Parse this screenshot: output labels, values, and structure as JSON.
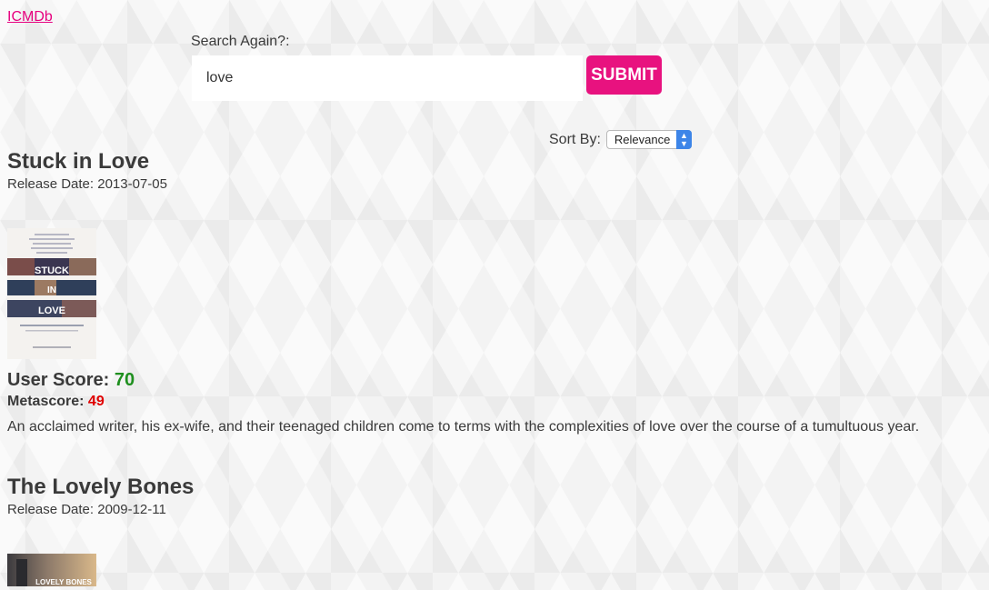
{
  "brand": {
    "label": "ICMDb"
  },
  "search": {
    "label": "Search Again?:",
    "value": "love",
    "submit_label": "SUBMIT"
  },
  "sort": {
    "label": "Sort By:",
    "selected": "Relevance"
  },
  "results": [
    {
      "title": "Stuck in Love",
      "release_date": "Release Date: 2013-07-05",
      "poster_text": [
        "STUCK",
        "IN",
        "LOVE"
      ],
      "user_score_label": "User Score: ",
      "user_score": "70",
      "metascore_label": "Metascore: ",
      "metascore": "49",
      "overview": "An acclaimed writer, his ex-wife, and their teenaged children come to terms with the complexities of love over the course of a tumultuous year."
    },
    {
      "title": "The Lovely Bones",
      "release_date": "Release Date: 2009-12-11",
      "poster_text": [
        "LOVELY BONES"
      ]
    }
  ],
  "colors": {
    "accent": "#e8127f",
    "user_score": "#1e8f1e",
    "metascore": "#e00000"
  }
}
